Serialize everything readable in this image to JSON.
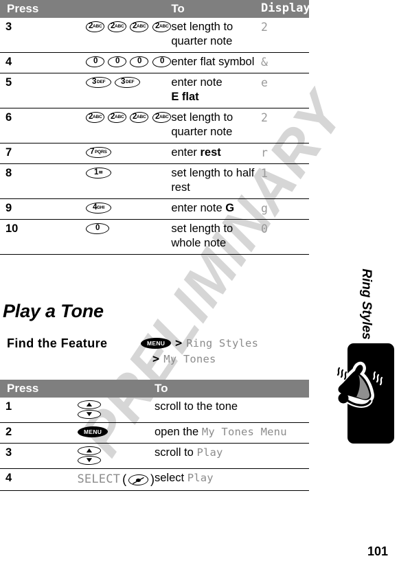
{
  "page": {
    "number": "101",
    "watermark": "PRELIMINARY"
  },
  "margin": {
    "label": "Ring Styles",
    "icon": "bell-icon"
  },
  "table1": {
    "headers": {
      "press": "Press",
      "to": "To",
      "display": "Display"
    },
    "rows": [
      {
        "num": "3",
        "keys": [
          {
            "type": "num-key",
            "digit": "2",
            "sub": "ABC"
          },
          {
            "type": "num-key",
            "digit": "2",
            "sub": "ABC"
          },
          {
            "type": "num-key",
            "digit": "2",
            "sub": "ABC"
          },
          {
            "type": "num-key",
            "digit": "2",
            "sub": "ABC"
          }
        ],
        "to": "set length to quarter note",
        "display": "2"
      },
      {
        "num": "4",
        "keys": [
          {
            "type": "num-key",
            "digit": "0",
            "sub": ""
          },
          {
            "type": "num-key",
            "digit": "0",
            "sub": ""
          },
          {
            "type": "num-key",
            "digit": "0",
            "sub": ""
          },
          {
            "type": "num-key",
            "digit": "0",
            "sub": ""
          }
        ],
        "to": "enter flat symbol",
        "display": "&"
      },
      {
        "num": "5",
        "keys": [
          {
            "type": "num-key",
            "digit": "3",
            "sub": "DEF"
          },
          {
            "type": "num-key",
            "digit": "3",
            "sub": "DEF"
          }
        ],
        "to_plain": "enter note ",
        "to_bold": "E flat",
        "display": "e"
      },
      {
        "num": "6",
        "keys": [
          {
            "type": "num-key",
            "digit": "2",
            "sub": "ABC"
          },
          {
            "type": "num-key",
            "digit": "2",
            "sub": "ABC"
          },
          {
            "type": "num-key",
            "digit": "2",
            "sub": "ABC"
          },
          {
            "type": "num-key",
            "digit": "2",
            "sub": "ABC"
          }
        ],
        "to": "set length to quarter note",
        "display": "2"
      },
      {
        "num": "7",
        "keys": [
          {
            "type": "num-key",
            "digit": "7",
            "sub": "PQRS"
          }
        ],
        "to_plain": "enter ",
        "to_bold": "rest",
        "display": "r"
      },
      {
        "num": "8",
        "keys": [
          {
            "type": "num-key",
            "digit": "1",
            "sub": "✉"
          }
        ],
        "to": "set length to half rest",
        "display": "1"
      },
      {
        "num": "9",
        "keys": [
          {
            "type": "num-key",
            "digit": "4",
            "sub": "GHI"
          }
        ],
        "to_plain": "enter note ",
        "to_bold": "G",
        "display": "g"
      },
      {
        "num": "10",
        "keys": [
          {
            "type": "num-key",
            "digit": "0",
            "sub": ""
          }
        ],
        "to": "set length to whole note",
        "display": "0"
      }
    ]
  },
  "section": {
    "heading": "Play a Tone"
  },
  "find_feature": {
    "label": "Find the Feature",
    "menu_key": "MENU",
    "separator": ">",
    "path1": "Ring Styles",
    "path2": "My Tones"
  },
  "table2": {
    "headers": {
      "press": "Press",
      "to": "To"
    },
    "rows": [
      {
        "num": "1",
        "keys": [
          {
            "type": "arrow-up-key",
            "glyph": "▲"
          },
          {
            "type": "arrow-down-key",
            "glyph": "▼"
          }
        ],
        "to": "scroll to the tone"
      },
      {
        "num": "2",
        "keys": [
          {
            "type": "menu-key",
            "label": "MENU"
          }
        ],
        "to_plain": "open the ",
        "to_mono": "My Tones Menu"
      },
      {
        "num": "3",
        "keys": [
          {
            "type": "arrow-up-key",
            "glyph": "▲"
          },
          {
            "type": "arrow-down-key",
            "glyph": "▼"
          }
        ],
        "to_plain": "scroll to ",
        "to_mono": "Play"
      },
      {
        "num": "4",
        "softkey_label": "SELECT",
        "softkey_open": "(",
        "softkey_close": ")",
        "to_plain": "select ",
        "to_mono": "Play"
      }
    ]
  }
}
